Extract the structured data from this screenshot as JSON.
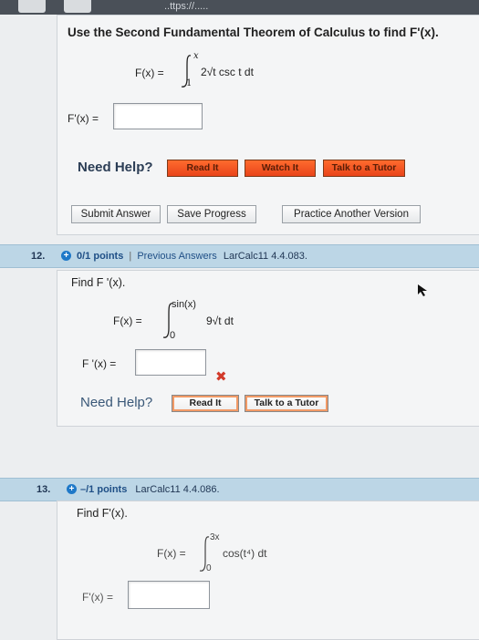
{
  "browser": {
    "url_fragment": "..ttps://....."
  },
  "q11": {
    "prompt": "Use the Second Fundamental Theorem of Calculus to find F'(x).",
    "fx_lhs": "F(x) =",
    "upper": "x",
    "lower": "1",
    "integrand": "2√t csc t dt",
    "answer_label": "F'(x) =",
    "answer_value": "",
    "need_help": "Need Help?",
    "buttons": {
      "read": "Read It",
      "watch": "Watch It",
      "tutor": "Talk to a Tutor"
    },
    "submit": "Submit Answer",
    "save": "Save Progress",
    "practice": "Practice Another Version"
  },
  "q12": {
    "number": "12.",
    "points": "0/1 points",
    "separator": "|",
    "prev_answers": "Previous Answers",
    "code": "LarCalc11 4.4.083.",
    "find": "Find F '(x).",
    "fx_lhs": "F(x) =",
    "upper": "sin(x)",
    "lower": "0",
    "integrand": "9√t dt",
    "answer_label": "F '(x) =",
    "answer_value": "",
    "need_help": "Need Help?",
    "buttons": {
      "read": "Read It",
      "tutor": "Talk to a Tutor"
    }
  },
  "q13": {
    "number": "13.",
    "points": "–/1 points",
    "code": "LarCalc11 4.4.086.",
    "find": "Find F'(x).",
    "fx_lhs": "F(x) =",
    "upper": "3x",
    "lower": "0",
    "integrand": "cos(t⁴) dt",
    "answer_label": "F'(x) =",
    "answer_value": ""
  },
  "colors": {
    "accent": "#1e78c8",
    "help_btn": "#ff6b2e",
    "header_bar": "#bcd6e6",
    "error": "#d23a2a"
  },
  "icons": [
    "plus-circle-icon",
    "x-mark-icon",
    "mouse-pointer-icon",
    "integral-sign-icon"
  ]
}
